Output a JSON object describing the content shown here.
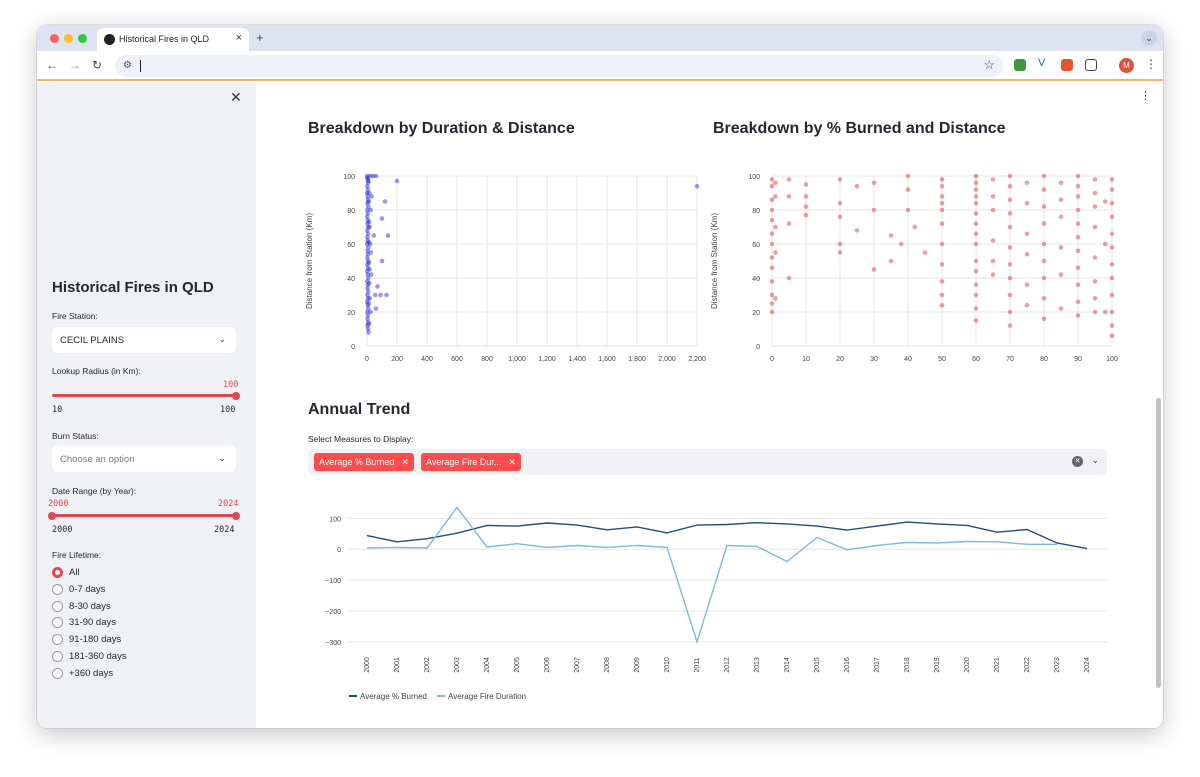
{
  "browser": {
    "tab_title": "Historical Fires in QLD",
    "new_tab": "+",
    "address": ""
  },
  "colors": {
    "accent": "#ff4b4b",
    "duration_points": "#1a1ad6",
    "burn_points": "#d62728",
    "line_burned": "#1f4e79",
    "line_duration": "#7fb8dc"
  },
  "sidebar": {
    "title": "Historical Fires in QLD",
    "fire_station_label": "Fire Station:",
    "fire_station_value": "CECIL PLAINS",
    "radius_label": "Lookup Radius (in Km):",
    "radius_value": "100",
    "radius_min": "10",
    "radius_max": "100",
    "burn_status_label": "Burn Status:",
    "burn_status_placeholder": "Choose an option",
    "date_range_label": "Date Range (by Year):",
    "date_low": "2000",
    "date_high": "2024",
    "date_min": "2000",
    "date_max": "2024",
    "lifetime_label": "Fire Lifetime:",
    "lifetime_options": [
      "All",
      "0-7 days",
      "8-30 days",
      "31-90 days",
      "91-180 days",
      "181-360 days",
      "+360 days"
    ],
    "lifetime_selected": "All"
  },
  "main": {
    "chart1_title": "Breakdown by Duration & Distance",
    "chart2_title": "Breakdown by % Burned and Distance",
    "chart3_title": "Annual Trend",
    "measures_label": "Select Measures to Display:",
    "chips": [
      "Average % Burned",
      "Average Fire Dur..."
    ]
  },
  "chart_data": [
    {
      "type": "scatter",
      "title": "Breakdown by Duration & Distance",
      "xlabel": "Fire Duration (Days)",
      "ylabel": "Distance from Station (Km)",
      "xlim": [
        0,
        2200
      ],
      "ylim": [
        0,
        100
      ],
      "xticks": [
        "0",
        "200",
        "400",
        "600",
        "800",
        "1,000",
        "1,200",
        "1,400",
        "1,600",
        "1,800",
        "2,000",
        "2,200"
      ],
      "yticks": [
        "0",
        "20",
        "40",
        "60",
        "80",
        "100"
      ],
      "points": [
        [
          0,
          100
        ],
        [
          3,
          99
        ],
        [
          5,
          98
        ],
        [
          8,
          96
        ],
        [
          2,
          94
        ],
        [
          6,
          92
        ],
        [
          1,
          90
        ],
        [
          4,
          88
        ],
        [
          7,
          86
        ],
        [
          3,
          84
        ],
        [
          9,
          82
        ],
        [
          2,
          80
        ],
        [
          5,
          78
        ],
        [
          1,
          76
        ],
        [
          6,
          74
        ],
        [
          4,
          72
        ],
        [
          8,
          70
        ],
        [
          2,
          68
        ],
        [
          7,
          66
        ],
        [
          3,
          64
        ],
        [
          5,
          62
        ],
        [
          1,
          60
        ],
        [
          9,
          58
        ],
        [
          4,
          56
        ],
        [
          6,
          54
        ],
        [
          2,
          52
        ],
        [
          8,
          50
        ],
        [
          3,
          48
        ],
        [
          7,
          46
        ],
        [
          1,
          44
        ],
        [
          5,
          42
        ],
        [
          9,
          40
        ],
        [
          2,
          38
        ],
        [
          6,
          36
        ],
        [
          4,
          34
        ],
        [
          8,
          32
        ],
        [
          3,
          30
        ],
        [
          7,
          28
        ],
        [
          1,
          26
        ],
        [
          5,
          24
        ],
        [
          9,
          22
        ],
        [
          2,
          20
        ],
        [
          6,
          18
        ],
        [
          4,
          16
        ],
        [
          8,
          14
        ],
        [
          3,
          12
        ],
        [
          7,
          10
        ],
        [
          10,
          97
        ],
        [
          12,
          85
        ],
        [
          14,
          73
        ],
        [
          11,
          61
        ],
        [
          13,
          49
        ],
        [
          15,
          37
        ],
        [
          12,
          25
        ],
        [
          14,
          13
        ],
        [
          10,
          8
        ],
        [
          16,
          90
        ],
        [
          18,
          70
        ],
        [
          17,
          45
        ],
        [
          19,
          28
        ],
        [
          20,
          100
        ],
        [
          25,
          80
        ],
        [
          22,
          60
        ],
        [
          28,
          42
        ],
        [
          24,
          20
        ],
        [
          30,
          88
        ],
        [
          26,
          55
        ],
        [
          40,
          100
        ],
        [
          45,
          65
        ],
        [
          55,
          30
        ],
        [
          60,
          22
        ],
        [
          70,
          35
        ],
        [
          90,
          30
        ],
        [
          60,
          100
        ],
        [
          100,
          50
        ],
        [
          120,
          85
        ],
        [
          140,
          65
        ],
        [
          130,
          30
        ],
        [
          100,
          75
        ],
        [
          200,
          97
        ],
        [
          2200,
          94
        ]
      ]
    },
    {
      "type": "scatter",
      "title": "Breakdown by % Burned and Distance",
      "xlabel": "Burn Percentage",
      "ylabel": "Distance from Station (Km)",
      "xlim": [
        0,
        100
      ],
      "ylim": [
        0,
        100
      ],
      "xticks": [
        "0",
        "10",
        "20",
        "30",
        "40",
        "50",
        "60",
        "70",
        "80",
        "90",
        "100"
      ],
      "yticks": [
        "0",
        "20",
        "40",
        "60",
        "80",
        "100"
      ],
      "columns_x": [
        0,
        1,
        5,
        10,
        20,
        30,
        40,
        50,
        60,
        65,
        70,
        75,
        80,
        85,
        90,
        95,
        100
      ],
      "points": [
        [
          0,
          98
        ],
        [
          0,
          94
        ],
        [
          0,
          86
        ],
        [
          0,
          80
        ],
        [
          0,
          74
        ],
        [
          0,
          66
        ],
        [
          0,
          60
        ],
        [
          0,
          52
        ],
        [
          0,
          46
        ],
        [
          0,
          38
        ],
        [
          0,
          30
        ],
        [
          0,
          25
        ],
        [
          0,
          20
        ],
        [
          1,
          96
        ],
        [
          1,
          88
        ],
        [
          1,
          70
        ],
        [
          1,
          55
        ],
        [
          1,
          28
        ],
        [
          5,
          98
        ],
        [
          5,
          88
        ],
        [
          5,
          72
        ],
        [
          5,
          40
        ],
        [
          10,
          95
        ],
        [
          10,
          88
        ],
        [
          10,
          82
        ],
        [
          10,
          77
        ],
        [
          20,
          98
        ],
        [
          20,
          84
        ],
        [
          20,
          76
        ],
        [
          20,
          60
        ],
        [
          20,
          55
        ],
        [
          25,
          68
        ],
        [
          25,
          94
        ],
        [
          30,
          96
        ],
        [
          30,
          80
        ],
        [
          30,
          45
        ],
        [
          35,
          50
        ],
        [
          35,
          65
        ],
        [
          38,
          60
        ],
        [
          40,
          100
        ],
        [
          40,
          92
        ],
        [
          40,
          80
        ],
        [
          42,
          70
        ],
        [
          45,
          55
        ],
        [
          50,
          98
        ],
        [
          50,
          94
        ],
        [
          50,
          88
        ],
        [
          50,
          84
        ],
        [
          50,
          80
        ],
        [
          50,
          72
        ],
        [
          50,
          60
        ],
        [
          50,
          48
        ],
        [
          50,
          38
        ],
        [
          50,
          30
        ],
        [
          50,
          24
        ],
        [
          60,
          100
        ],
        [
          60,
          96
        ],
        [
          60,
          92
        ],
        [
          60,
          88
        ],
        [
          60,
          84
        ],
        [
          60,
          78
        ],
        [
          60,
          72
        ],
        [
          60,
          66
        ],
        [
          60,
          60
        ],
        [
          60,
          50
        ],
        [
          60,
          44
        ],
        [
          60,
          36
        ],
        [
          60,
          30
        ],
        [
          60,
          22
        ],
        [
          60,
          15
        ],
        [
          65,
          98
        ],
        [
          65,
          88
        ],
        [
          65,
          80
        ],
        [
          65,
          62
        ],
        [
          65,
          50
        ],
        [
          65,
          42
        ],
        [
          70,
          100
        ],
        [
          70,
          94
        ],
        [
          70,
          86
        ],
        [
          70,
          78
        ],
        [
          70,
          70
        ],
        [
          70,
          58
        ],
        [
          70,
          48
        ],
        [
          70,
          40
        ],
        [
          70,
          30
        ],
        [
          70,
          20
        ],
        [
          70,
          12
        ],
        [
          75,
          96
        ],
        [
          75,
          84
        ],
        [
          75,
          66
        ],
        [
          75,
          54
        ],
        [
          75,
          36
        ],
        [
          75,
          24
        ],
        [
          80,
          100
        ],
        [
          80,
          92
        ],
        [
          80,
          82
        ],
        [
          80,
          72
        ],
        [
          80,
          60
        ],
        [
          80,
          50
        ],
        [
          80,
          40
        ],
        [
          80,
          28
        ],
        [
          80,
          16
        ],
        [
          85,
          96
        ],
        [
          85,
          86
        ],
        [
          85,
          76
        ],
        [
          85,
          58
        ],
        [
          85,
          42
        ],
        [
          85,
          22
        ],
        [
          90,
          100
        ],
        [
          90,
          94
        ],
        [
          90,
          88
        ],
        [
          90,
          80
        ],
        [
          90,
          72
        ],
        [
          90,
          64
        ],
        [
          90,
          56
        ],
        [
          90,
          46
        ],
        [
          90,
          36
        ],
        [
          90,
          26
        ],
        [
          90,
          18
        ],
        [
          95,
          98
        ],
        [
          95,
          90
        ],
        [
          95,
          82
        ],
        [
          95,
          70
        ],
        [
          95,
          52
        ],
        [
          95,
          38
        ],
        [
          95,
          28
        ],
        [
          95,
          20
        ],
        [
          100,
          98
        ],
        [
          100,
          92
        ],
        [
          100,
          84
        ],
        [
          100,
          76
        ],
        [
          100,
          66
        ],
        [
          100,
          58
        ],
        [
          100,
          48
        ],
        [
          100,
          40
        ],
        [
          100,
          30
        ],
        [
          100,
          20
        ],
        [
          100,
          12
        ],
        [
          100,
          6
        ],
        [
          98,
          85
        ],
        [
          98,
          60
        ],
        [
          98,
          20
        ]
      ]
    },
    {
      "type": "line",
      "title": "Annual Trend",
      "x": [
        "2000",
        "2001",
        "2002",
        "2003",
        "2004",
        "2005",
        "2006",
        "2007",
        "2008",
        "2009",
        "2010",
        "2011",
        "2012",
        "2013",
        "2014",
        "2015",
        "2016",
        "2017",
        "2018",
        "2019",
        "2020",
        "2021",
        "2022",
        "2023",
        "2024"
      ],
      "ylim": [
        -320,
        140
      ],
      "yticks": [
        "100",
        "0",
        "−100",
        "−200",
        "−300"
      ],
      "series": [
        {
          "name": "Average % Burned",
          "values": [
            44,
            24,
            34,
            52,
            77,
            75,
            85,
            78,
            63,
            72,
            53,
            78,
            80,
            86,
            82,
            75,
            62,
            75,
            88,
            82,
            77,
            55,
            64,
            20,
            2
          ]
        },
        {
          "name": "Average Fire Duration",
          "values": [
            4,
            6,
            4,
            135,
            7,
            18,
            6,
            12,
            6,
            12,
            6,
            -300,
            12,
            9,
            -40,
            38,
            -2,
            12,
            22,
            20,
            25,
            24,
            16,
            16,
            null
          ]
        }
      ],
      "legend": "bottom-left"
    }
  ]
}
